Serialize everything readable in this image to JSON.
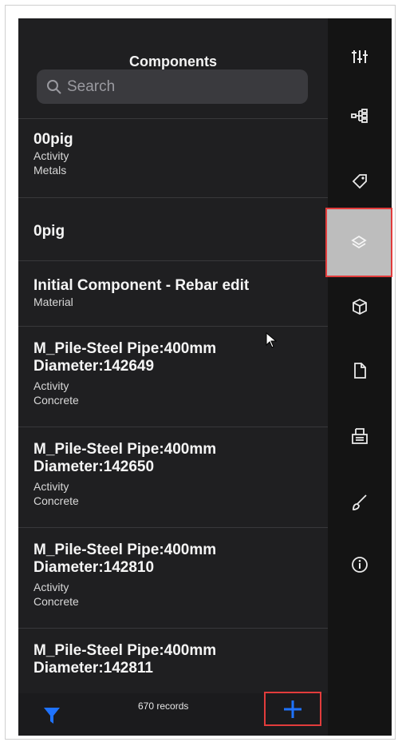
{
  "header": {
    "title": "Components"
  },
  "search": {
    "placeholder": "Search"
  },
  "list": {
    "items": [
      {
        "title": "00pig",
        "subtitle_1": "Activity",
        "subtitle_2": "Metals"
      },
      {
        "title": "0pig"
      },
      {
        "title": "Initial Component - Rebar edit",
        "subtitle_1": "Material"
      },
      {
        "title_line_1": "M_Pile-Steel Pipe:400mm",
        "title_line_2": "Diameter:142649",
        "subtitle_1": "Activity",
        "subtitle_2": "Concrete"
      },
      {
        "title_line_1": "M_Pile-Steel Pipe:400mm",
        "title_line_2": "Diameter:142650",
        "subtitle_1": "Activity",
        "subtitle_2": "Concrete"
      },
      {
        "title_line_1": "M_Pile-Steel Pipe:400mm",
        "title_line_2": "Diameter:142810",
        "subtitle_1": "Activity",
        "subtitle_2": "Concrete"
      },
      {
        "title_line_1": "M_Pile-Steel Pipe:400mm",
        "title_line_2": "Diameter:142811"
      }
    ]
  },
  "footer": {
    "records": "670 records"
  },
  "sidebar": {
    "icons": [
      "sliders-icon",
      "hierarchy-icon",
      "tag-icon",
      "layers-icon",
      "cube-icon",
      "document-icon",
      "printer-icon",
      "brush-icon",
      "info-icon"
    ],
    "active_index": 3
  },
  "colors": {
    "accent": "#1f73ff",
    "highlight": "#e23c3c"
  }
}
